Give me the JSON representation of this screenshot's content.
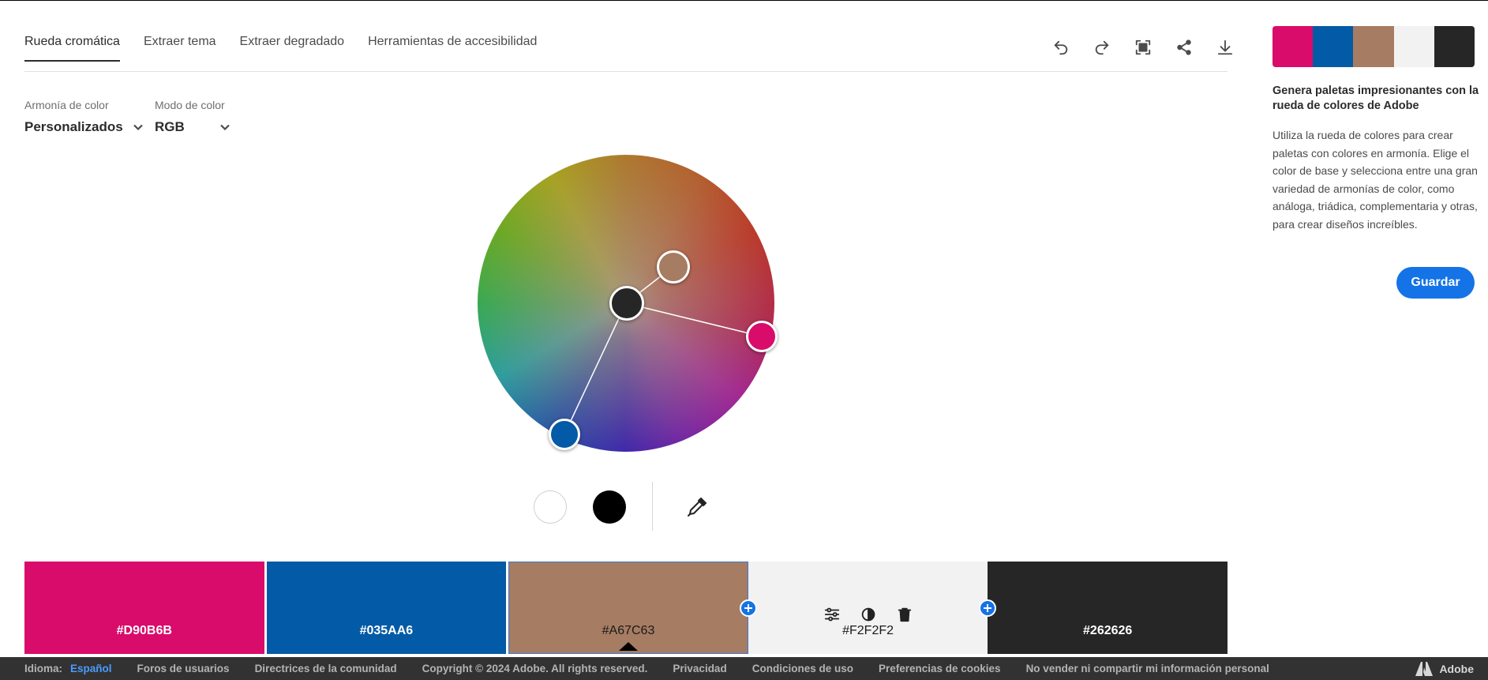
{
  "tabs": [
    {
      "label": "Rueda cromática",
      "active": true
    },
    {
      "label": "Extraer tema",
      "active": false
    },
    {
      "label": "Extraer degradado",
      "active": false
    },
    {
      "label": "Herramientas de accesibilidad",
      "active": false
    }
  ],
  "toolbar": {
    "icons": [
      "undo-icon",
      "redo-icon",
      "fullscreen-icon",
      "share-icon",
      "download-icon"
    ]
  },
  "harmony": {
    "label": "Armonía de color",
    "value": "Personalizados"
  },
  "mode": {
    "label": "Modo de color",
    "value": "RGB"
  },
  "wheel": {
    "base_color": "#262626",
    "handles": [
      "#262626",
      "#A67C63",
      "#D90B6B",
      "#035AA6"
    ]
  },
  "quick_colors": {
    "white": "#FFFFFF",
    "black": "#000000",
    "picker_icon": "eyedropper-icon"
  },
  "palette": [
    {
      "hex": "#D90B6B",
      "text_color": "#FFFFFF"
    },
    {
      "hex": "#035AA6",
      "text_color": "#FFFFFF"
    },
    {
      "hex": "#A67C63",
      "text_color": "#1A1A1A"
    },
    {
      "hex": "#F2F2F2",
      "text_color": "#1A1A1A"
    },
    {
      "hex": "#262626",
      "text_color": "#FFFFFF"
    }
  ],
  "cell_tools": [
    "sliders-icon",
    "contrast-icon",
    "trash-icon"
  ],
  "sidebar": {
    "title": "Genera paletas impresionantes con la rueda de colores de Adobe",
    "description": "Utiliza la rueda de colores para crear paletas con colores en armonía. Elige el color de base y selecciona entre una gran variedad de armonías de color, como análoga, triádica, complementaria y otras, para crear diseños increíbles.",
    "save_label": "Guardar"
  },
  "footer": {
    "language_label": "Idioma:",
    "language_value": "Español",
    "links": [
      "Foros de usuarios",
      "Directrices de la comunidad",
      "Copyright © 2024 Adobe. All rights reserved.",
      "Privacidad",
      "Condiciones de uso",
      "Preferencias de cookies",
      "No vender ni compartir mi información personal"
    ],
    "brand": "Adobe"
  }
}
